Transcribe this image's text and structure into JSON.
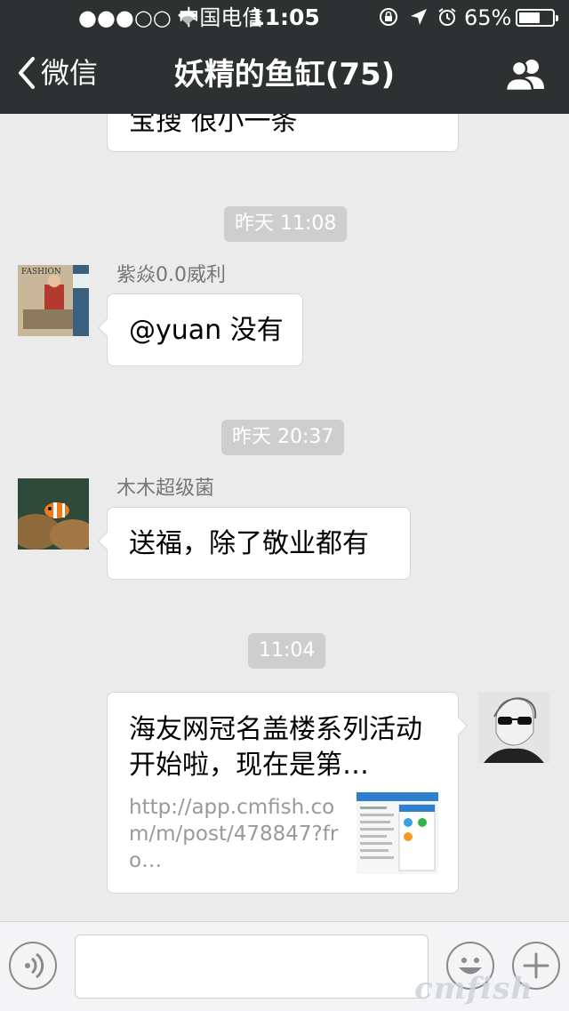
{
  "status_bar": {
    "carrier": "●●●○○ 中国电信",
    "time": "11:05",
    "battery_percent_label": "65%",
    "battery_level": 0.65,
    "icons": [
      "signal-dots-icon",
      "wifi-icon",
      "rotation-lock-icon",
      "location-arrow-icon",
      "alarm-icon",
      "battery-icon"
    ]
  },
  "nav": {
    "back_label": "微信",
    "title": "妖精的鱼缸(75)",
    "back_icon": "chevron-left-icon",
    "members_icon": "group-members-icon"
  },
  "messages": [
    {
      "type": "text",
      "side": "left",
      "text": "宝搜 很小一条",
      "partially_visible": true
    },
    {
      "type": "timestamp",
      "text": "昨天 11:08"
    },
    {
      "type": "text",
      "side": "left",
      "sender": "紫焱0.0威利",
      "avatar": "fashion-magazine-avatar",
      "avatar_text": "FASHION",
      "text": "@yuan 没有"
    },
    {
      "type": "timestamp",
      "text": "昨天 20:37"
    },
    {
      "type": "text",
      "side": "left",
      "sender": "木木超级菌",
      "avatar": "clownfish-avatar",
      "text": "送福，除了敬业都有"
    },
    {
      "type": "timestamp",
      "text": "11:04"
    },
    {
      "type": "link",
      "side": "right",
      "avatar": "sunglasses-sketch-avatar",
      "title": "海友网冠名盖楼系列活动开始啦，现在是第…",
      "url": "http://app.cmfish.com/m/post/478847?fro…",
      "thumbnail": "app-screenshot-thumbnail"
    }
  ],
  "input_bar": {
    "voice_icon": "voice-icon",
    "emoji_icon": "emoji-smile-icon",
    "more_icon": "plus-icon",
    "message_value": ""
  },
  "watermark": "cmfish",
  "colors": {
    "nav_background": "#2e3132",
    "chat_background": "#ebebeb",
    "timestamp_background": "#cecece",
    "sender_name": "#777777",
    "link_url": "#999999"
  }
}
